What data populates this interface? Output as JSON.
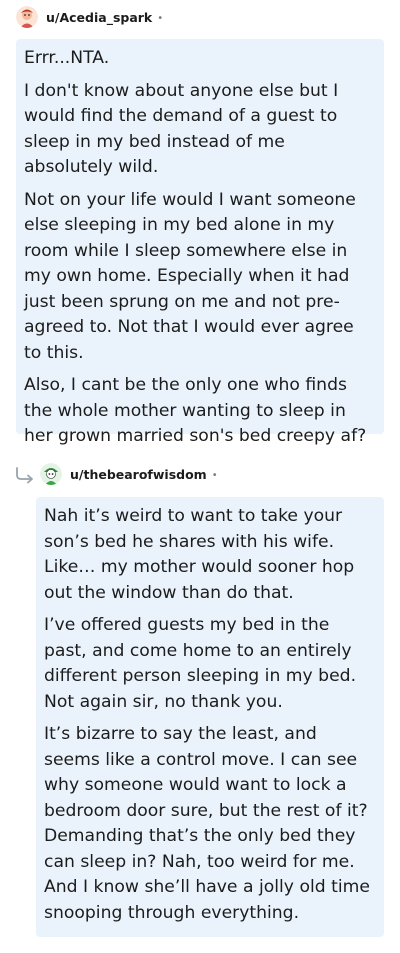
{
  "comment": {
    "username": "u/Acedia_spark",
    "paragraphs": [
      "Errr...NTA.",
      "I don't know about anyone else but I would find the demand of a guest to sleep in my bed instead of me absolutely wild.",
      "Not on your life would I want someone else sleeping in my bed alone in my room while I sleep somewhere else in my own home. Especially when it had just been sprung on me and not pre-agreed to. Not that I would ever agree to this.",
      "Also, I cant be the only one who finds the whole mother wanting to sleep in her grown married son's bed creepy af?"
    ]
  },
  "reply": {
    "username": "u/thebearofwisdom",
    "paragraphs": [
      "Nah it’s weird to want to take your son’s bed he shares with his wife. Like… my mother would sooner hop out the window than do that.",
      "I’ve offered guests my bed in the past, and come home to an entirely different person sleeping in my bed. Not again sir, no thank you.",
      "It’s bizarre to say the least, and seems like a control move. I can see why someone would want to lock a bedroom door sure, but the rest of it? Demanding that’s the only bed they can sleep in? Nah, too weird for me. And I know she’ll have a jolly old time snooping through everything."
    ]
  },
  "separator": "•",
  "icons": {
    "avatar1": "snoo-avatar-icon",
    "avatar2": "snoo-avatar-icon",
    "reply": "reply-arrow-icon"
  }
}
